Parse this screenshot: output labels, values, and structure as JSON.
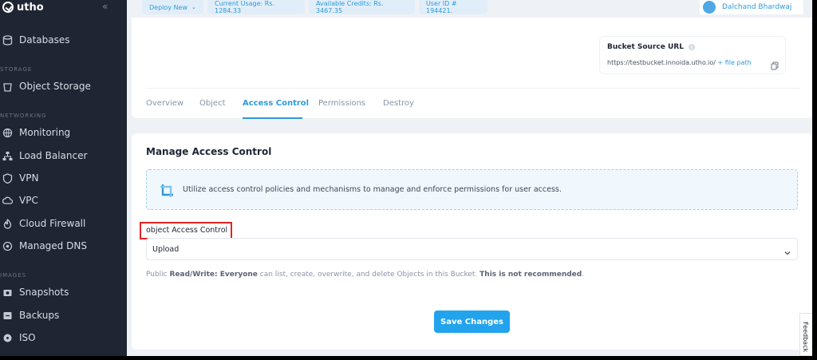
{
  "sidebar": {
    "brand": "utho",
    "collapse_glyph": "«",
    "sections": [
      {
        "label": "STORAGE"
      },
      {
        "label": "NETWORKING"
      },
      {
        "label": "IMAGES"
      }
    ],
    "items": [
      {
        "label": "Databases",
        "icon": "database-icon"
      },
      {
        "label": "Object Storage",
        "icon": "bucket-icon"
      },
      {
        "label": "Monitoring",
        "icon": "globe-icon"
      },
      {
        "label": "Load Balancer",
        "icon": "load-balancer-icon"
      },
      {
        "label": "VPN",
        "icon": "shield-icon"
      },
      {
        "label": "VPC",
        "icon": "cloud-icon"
      },
      {
        "label": "Cloud Firewall",
        "icon": "firewall-icon"
      },
      {
        "label": "Managed DNS",
        "icon": "dns-icon"
      },
      {
        "label": "Snapshots",
        "icon": "snapshot-icon"
      },
      {
        "label": "Backups",
        "icon": "backup-icon"
      },
      {
        "label": "ISO",
        "icon": "disk-icon"
      }
    ]
  },
  "topbar": {
    "deploy": "Deploy New",
    "usage": "Current Usage: Rs. 1284.33",
    "credits": "Available Credits: Rs. 3467.35",
    "user_id": "User ID # 194421.",
    "user_name": "Dalchand Bhardwaj"
  },
  "bucket": {
    "title": "Bucket Source URL",
    "info": "i",
    "url": "https://testbucket.innoida.utho.io/",
    "file_path": "+ file path"
  },
  "tabs": [
    "Overview",
    "Object",
    "Access Control",
    "Permissions",
    "Destroy"
  ],
  "active_tab": "Access Control",
  "main": {
    "title": "Manage Access Control",
    "notice": "Utilize access control policies and mechanisms to manage and enforce permissions for user access.",
    "field_label": "object Access Control",
    "select_value": "Upload",
    "help_prefix": "Public ",
    "help_mode": "Read/Write",
    "help_colon": ": ",
    "help_everyone": "Everyone",
    "help_mid": " can list, create, overwrite, and delete Objects in this Bucket. ",
    "help_warning": "This is not recommended",
    "help_end": ".",
    "save_label": "Save Changes"
  },
  "feedback": "Feedback",
  "colors": {
    "sidebar_bg": "#1f2532",
    "accent": "#2f9ad8",
    "button": "#22a3ee",
    "highlight_box": "#e02424"
  }
}
